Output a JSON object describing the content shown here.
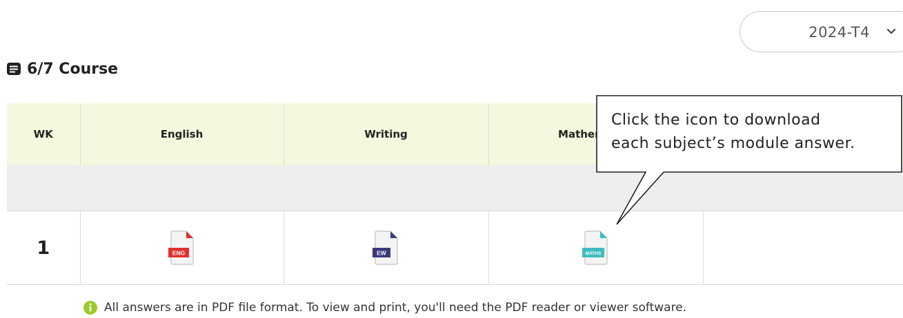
{
  "term_select": {
    "value": "2024-T4",
    "icon": "chevron-down-icon"
  },
  "heading": {
    "icon": "list-icon",
    "title": "6/7 Course"
  },
  "table": {
    "headers": {
      "wk": "WK",
      "english": "English",
      "writing": "Writing",
      "mathematics": "Mathematics"
    },
    "row": {
      "wk": "1",
      "english_badge": "ENG",
      "writing_badge": "EW",
      "maths_badge": "MATHS"
    }
  },
  "colors": {
    "english": "#e0312f",
    "writing": "#3a3a7c",
    "maths": "#3fbcc0"
  },
  "note": {
    "icon": "info-icon",
    "text": "All answers are in PDF file format. To view and print, you'll need the PDF reader or viewer software."
  },
  "callout": {
    "line1": "Click the icon to download",
    "line2": "each subject’s module answer."
  }
}
